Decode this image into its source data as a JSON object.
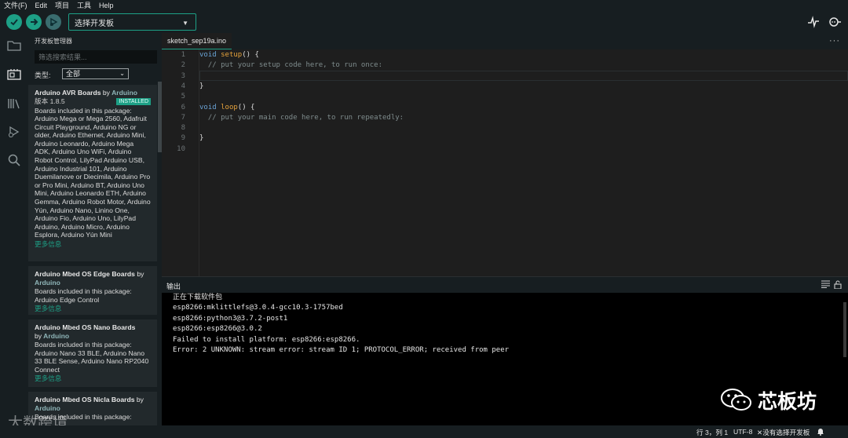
{
  "menu": [
    "文件(F)",
    "Edit",
    "项目",
    "工具",
    "Help"
  ],
  "toolbar": {
    "verify_icon": "check-icon",
    "upload_icon": "arrow-right-icon",
    "debug_icon": "debug-icon",
    "board_select": "选择开发板",
    "serial_plotter_icon": "pulse-icon",
    "serial_monitor_icon": "magnifier-dots-icon"
  },
  "sidebar": {
    "title": "开发板管理器",
    "filter_placeholder": "筛选搜索结果...",
    "type_label": "类型:",
    "type_value": "全部",
    "boards": [
      {
        "name": "Arduino AVR Boards",
        "by": "by",
        "author": "Arduino",
        "version": "版本 1.8.5",
        "badge": "INSTALLED",
        "desc": "Boards included in this package: Arduino Mega or Mega 2560, Adafruit Circuit Playground, Arduino NG or older, Arduino Ethernet, Arduino Mini, Arduino Leonardo, Arduino Mega ADK, Arduino Uno WiFi, Arduino Robot Control, LilyPad Arduino USB, Arduino Industrial 101, Arduino Duemilanove or Diecimila, Arduino Pro or Pro Mini, Arduino BT, Arduino Uno Mini, Arduino Leonardo ETH, Arduino Gemma, Arduino Robot Motor, Arduino Yún, Arduino Nano, Linino One, Arduino Fio, Arduino Uno, LilyPad Arduino, Arduino Micro, Arduino Esplora, Arduino Yún Mini",
        "more": "更多信息"
      },
      {
        "name": "Arduino Mbed OS Edge Boards",
        "by": "by",
        "author": "Arduino",
        "desc": "Boards included in this package: Arduino Edge Control",
        "more": "更多信息"
      },
      {
        "name": "Arduino Mbed OS Nano Boards",
        "by": "by",
        "author": "Arduino",
        "desc": "Boards included in this package: Arduino Nano 33 BLE, Arduino Nano 33 BLE Sense, Arduino Nano RP2040 Connect",
        "more": "更多信息"
      },
      {
        "name": "Arduino Mbed OS Nicla Boards",
        "by": "by",
        "author": "Arduino",
        "desc": "Boards included in this package:"
      }
    ]
  },
  "editor": {
    "tab": "sketch_sep19a.ino",
    "line_numbers": [
      "1",
      "2",
      "3",
      "4",
      "5",
      "6",
      "7",
      "8",
      "9",
      "10"
    ],
    "lines": {
      "l1_kw": "void",
      "l1_fn": "setup",
      "l1_rest": "() {",
      "l2": "  // put your setup code here, to run once:",
      "l4": "}",
      "l6_kw": "void",
      "l6_fn": "loop",
      "l6_rest": "() {",
      "l7": "  // put your main code here, to run repeatedly:",
      "l9": "}"
    }
  },
  "output": {
    "title": "输出",
    "lines": [
      "正在下载软件包",
      "esp8266:mklittlefs@3.0.4-gcc10.3-1757bed",
      "esp8266:python3@3.7.2-post1",
      "esp8266:esp8266@3.0.2",
      "Failed to install platform: esp8266:esp8266.",
      "Error: 2 UNKNOWN: stream error: stream ID 1; PROTOCOL_ERROR; received from peer"
    ]
  },
  "watermark": {
    "brand": "芯板坊",
    "brand_icon": "wechat-icon",
    "corner_text": "大数跨境"
  },
  "statusbar": {
    "position": "行 3，列 1",
    "encoding": "UTF-8",
    "board": "没有选择开发板",
    "board_icon": "close-icon",
    "notification_icon": "bell-icon"
  },
  "colors": {
    "accent": "#1da086",
    "panel": "#171e21",
    "editor_bg": "#1e1e1e",
    "output_bg": "#000000"
  }
}
